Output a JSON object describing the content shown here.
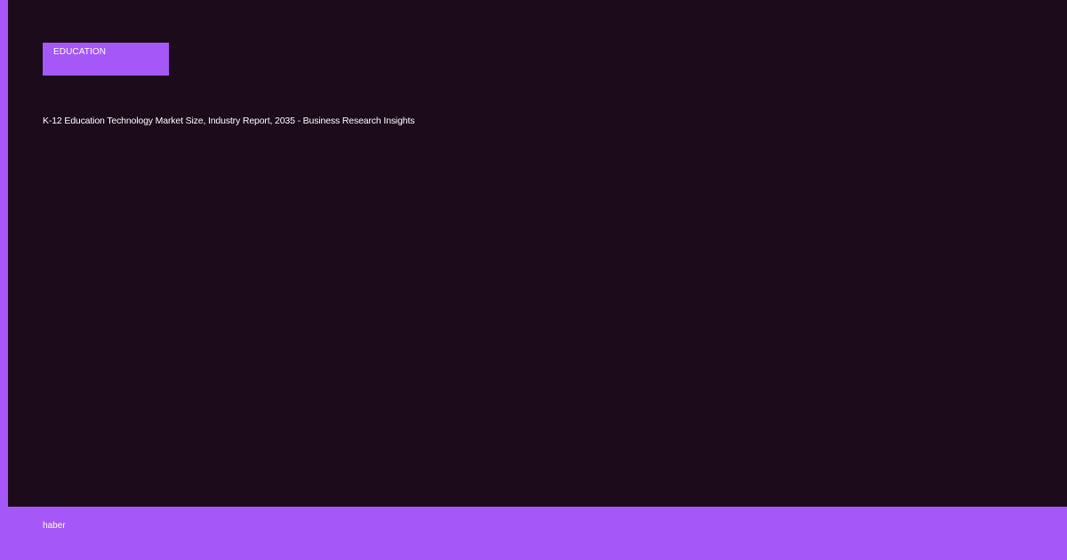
{
  "category": {
    "label": "EDUCATION"
  },
  "article": {
    "title": "K-12 Education Technology Market Size, Industry Report, 2035 - Business Research Insights"
  },
  "footer": {
    "site_name": "haber"
  },
  "colors": {
    "background": "#1b0b1b",
    "accent": "#a557f7",
    "text": "#ffffff"
  }
}
